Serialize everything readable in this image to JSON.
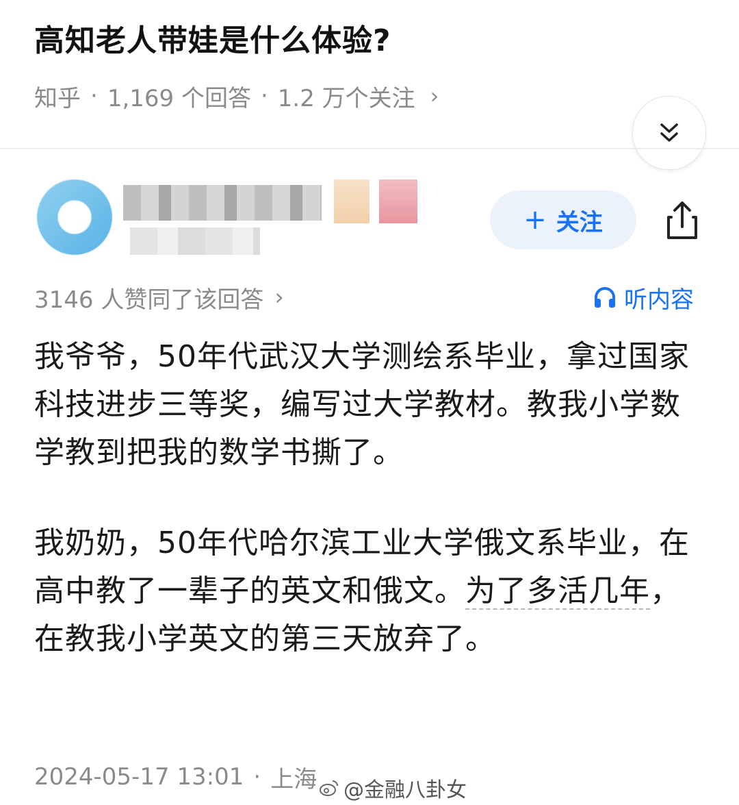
{
  "question": {
    "title": "高知老人带娃是什么体验?",
    "source": "知乎",
    "answers_count": "1,169 个回答",
    "followers_count": "1.2 万个关注"
  },
  "answer": {
    "follow_label": "关注",
    "upvote_text": "3146 人赞同了该回答",
    "listen_label": "听内容",
    "paragraph_1": "我爷爷，50年代武汉大学测绘系毕业，拿过国家科技进步三等奖，编写过大学教材。教我小学数学教到把我的数学书撕了。",
    "paragraph_2_before": "我奶奶，50年代哈尔滨工业大学俄文系毕业，在高中教了一辈子的英文和俄文。",
    "paragraph_2_link": "为了多活几年",
    "paragraph_2_after": "，在教我小学英文的第三天放弃了。",
    "date": "2024-05-17 13:01",
    "location": "上海"
  },
  "watermark": {
    "text": "@金融八卦女"
  },
  "colors": {
    "accent": "#1772f6",
    "follow_bg": "#ebf2fb",
    "meta_gray": "#8a8a8a"
  },
  "icons": [
    "double-chevron-down-icon",
    "plus-icon",
    "share-icon",
    "headphones-icon",
    "chevron-right-icon",
    "weibo-icon"
  ]
}
